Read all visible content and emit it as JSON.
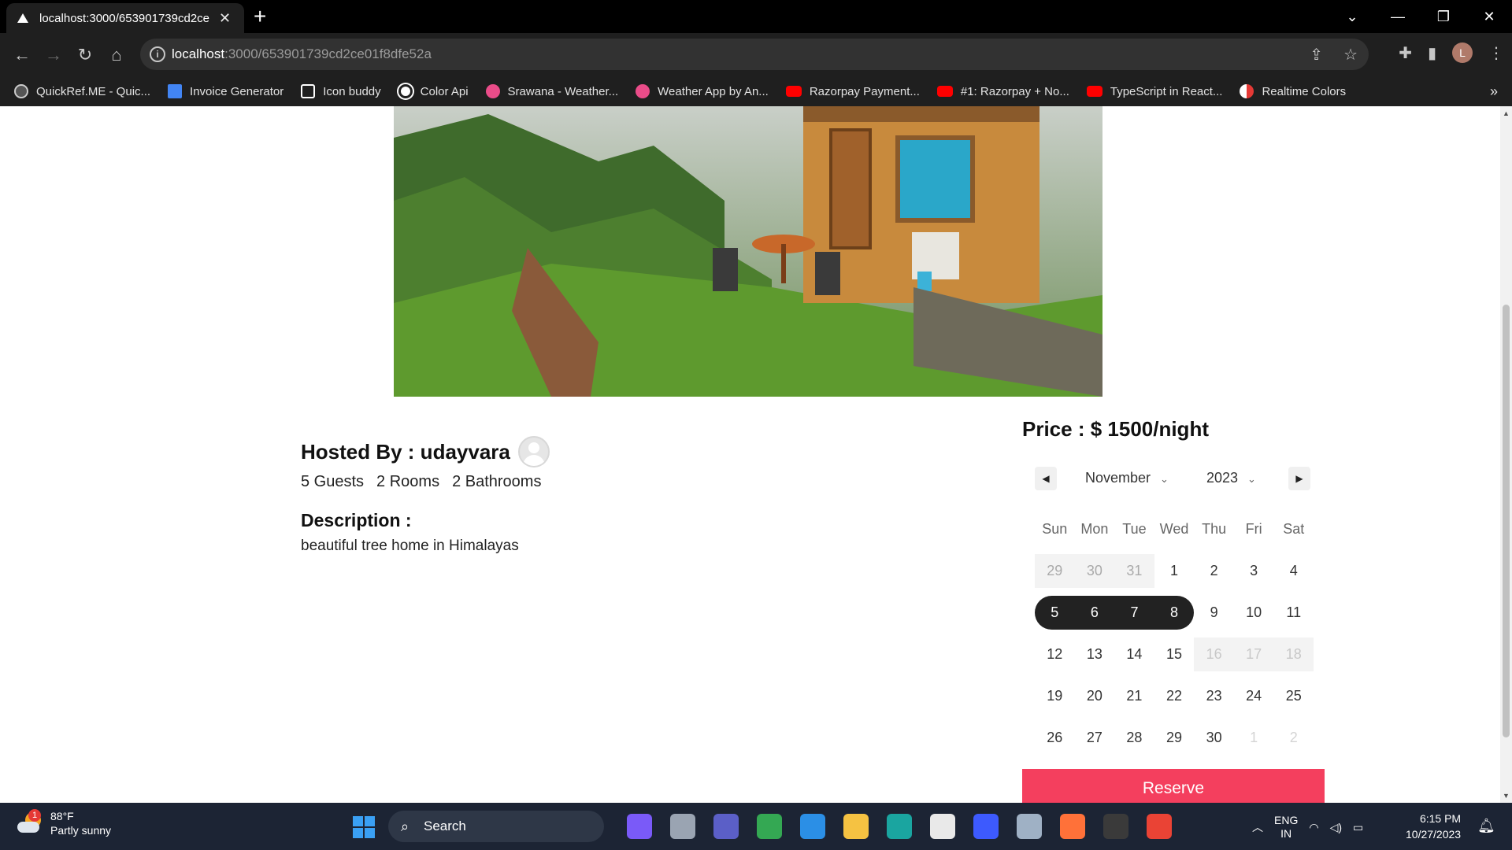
{
  "browser": {
    "tab_title": "localhost:3000/653901739cd2ce",
    "new_tab": "+",
    "url_host": "localhost",
    "url_rest": ":3000/653901739cd2ce01f8dfe52a",
    "bookmarks": [
      {
        "label": "QuickRef.ME - Quic...",
        "icon": "qr"
      },
      {
        "label": "Invoice Generator",
        "icon": "doc"
      },
      {
        "label": "Icon buddy",
        "icon": "icb"
      },
      {
        "label": "Color Api",
        "icon": "github"
      },
      {
        "label": "Srawana - Weather...",
        "icon": "dribbble"
      },
      {
        "label": "Weather App by An...",
        "icon": "dribbble"
      },
      {
        "label": "Razorpay Payment...",
        "icon": "yt"
      },
      {
        "label": "#1: Razorpay + No...",
        "icon": "yt"
      },
      {
        "label": "TypeScript in React...",
        "icon": "yt"
      },
      {
        "label": "Realtime Colors",
        "icon": "rc"
      }
    ],
    "profile_initial": "L"
  },
  "listing": {
    "hosted_by_label": "Hosted By : udayvara",
    "stats": [
      "5 Guests",
      "2 Rooms",
      "2 Bathrooms"
    ],
    "description_title": "Description :",
    "description": "beautiful tree home in Himalayas",
    "price": "Price : $ 1500/night",
    "reserve_label": "Reserve"
  },
  "calendar": {
    "month": "November",
    "year": "2023",
    "weekdays": [
      "Sun",
      "Mon",
      "Tue",
      "Wed",
      "Thu",
      "Fri",
      "Sat"
    ],
    "weeks": [
      [
        {
          "d": "29",
          "s": "muted"
        },
        {
          "d": "30",
          "s": "muted"
        },
        {
          "d": "31",
          "s": "muted"
        },
        {
          "d": "1",
          "s": ""
        },
        {
          "d": "2",
          "s": ""
        },
        {
          "d": "3",
          "s": ""
        },
        {
          "d": "4",
          "s": ""
        }
      ],
      [
        {
          "d": "5",
          "s": "sel start"
        },
        {
          "d": "6",
          "s": "sel"
        },
        {
          "d": "7",
          "s": "sel"
        },
        {
          "d": "8",
          "s": "sel end"
        },
        {
          "d": "9",
          "s": ""
        },
        {
          "d": "10",
          "s": ""
        },
        {
          "d": "11",
          "s": ""
        }
      ],
      [
        {
          "d": "12",
          "s": ""
        },
        {
          "d": "13",
          "s": ""
        },
        {
          "d": "14",
          "s": ""
        },
        {
          "d": "15",
          "s": ""
        },
        {
          "d": "16",
          "s": "disabled"
        },
        {
          "d": "17",
          "s": "disabled"
        },
        {
          "d": "18",
          "s": "disabled"
        }
      ],
      [
        {
          "d": "19",
          "s": ""
        },
        {
          "d": "20",
          "s": ""
        },
        {
          "d": "21",
          "s": ""
        },
        {
          "d": "22",
          "s": ""
        },
        {
          "d": "23",
          "s": ""
        },
        {
          "d": "24",
          "s": ""
        },
        {
          "d": "25",
          "s": ""
        }
      ],
      [
        {
          "d": "26",
          "s": ""
        },
        {
          "d": "27",
          "s": ""
        },
        {
          "d": "28",
          "s": ""
        },
        {
          "d": "29",
          "s": ""
        },
        {
          "d": "30",
          "s": ""
        },
        {
          "d": "1",
          "s": "faint"
        },
        {
          "d": "2",
          "s": "faint"
        }
      ]
    ]
  },
  "taskbar": {
    "weather_temp": "88°F",
    "weather_desc": "Partly sunny",
    "weather_badge": "1",
    "search_label": "Search",
    "lang_line1": "ENG",
    "lang_line2": "IN",
    "time": "6:15 PM",
    "date": "10/27/2023",
    "apps": [
      {
        "name": "copilot",
        "color": "#7a5af8"
      },
      {
        "name": "task-view",
        "color": "#9aa4b2"
      },
      {
        "name": "meet",
        "color": "#5b5fc7"
      },
      {
        "name": "chrome",
        "color": "#34a853"
      },
      {
        "name": "vscode",
        "color": "#2b8fe6"
      },
      {
        "name": "explorer",
        "color": "#f5c242"
      },
      {
        "name": "edge",
        "color": "#1aa5a0"
      },
      {
        "name": "store",
        "color": "#e9e9e9"
      },
      {
        "name": "drawboard",
        "color": "#3d5afe"
      },
      {
        "name": "calculator",
        "color": "#9fb1c5"
      },
      {
        "name": "firefox",
        "color": "#ff7139"
      },
      {
        "name": "terminal",
        "color": "#3a3a3a"
      },
      {
        "name": "chrome-profile",
        "color": "#ea4335"
      }
    ]
  },
  "colors": {
    "reserve": "#f43f5e",
    "selected_day": "#222222"
  }
}
